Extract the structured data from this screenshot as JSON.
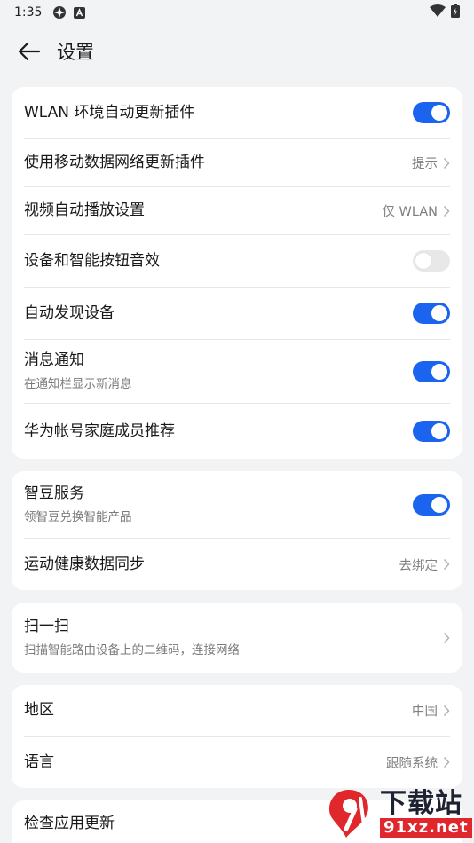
{
  "status": {
    "time": "1:35"
  },
  "header": {
    "title": "设置"
  },
  "card1": {
    "wlan_auto_update": {
      "label": "WLAN 环境自动更新插件",
      "on": true
    },
    "mobile_data_update": {
      "label": "使用移动数据网络更新插件",
      "value": "提示"
    },
    "video_autoplay": {
      "label": "视频自动播放设置",
      "value": "仅 WLAN"
    },
    "button_sound": {
      "label": "设备和智能按钮音效",
      "on": false
    },
    "auto_discover": {
      "label": "自动发现设备",
      "on": true
    },
    "notification": {
      "label": "消息通知",
      "sub": "在通知栏显示新消息",
      "on": true
    },
    "family_recommend": {
      "label": "华为帐号家庭成员推荐",
      "on": true
    }
  },
  "card2": {
    "zhidou": {
      "label": "智豆服务",
      "sub": "领智豆兑换智能产品",
      "on": true
    },
    "health_sync": {
      "label": "运动健康数据同步",
      "value": "去绑定"
    }
  },
  "card3": {
    "scan": {
      "label": "扫一扫",
      "sub": "扫描智能路由设备上的二维码，连接网络"
    }
  },
  "card4": {
    "region": {
      "label": "地区",
      "value": "中国"
    },
    "language": {
      "label": "语言",
      "value": "跟随系统"
    }
  },
  "card5": {
    "check_update": {
      "label": "检查应用更新"
    }
  },
  "watermark": {
    "big": "下载站",
    "small": "91xz.net"
  },
  "colors": {
    "accent": "#1a64f0",
    "background": "#f1f3f5"
  }
}
